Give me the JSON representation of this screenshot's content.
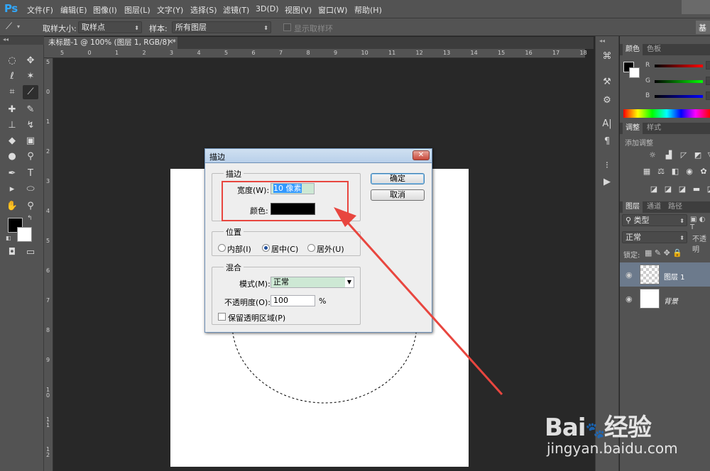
{
  "app": {
    "logo": "Ps"
  },
  "menu": [
    "文件(F)",
    "编辑(E)",
    "图像(I)",
    "图层(L)",
    "文字(Y)",
    "选择(S)",
    "滤镜(T)",
    "3D(D)",
    "视图(V)",
    "窗口(W)",
    "帮助(H)"
  ],
  "options": {
    "sample_size_label": "取样大小:",
    "sample_size_value": "取样点",
    "sample_label": "样本:",
    "sample_value": "所有图层",
    "show_ring": "显示取样环",
    "right_btn": "基"
  },
  "document": {
    "tab_title": "未标题-1 @ 100% (图层 1, RGB/8) *"
  },
  "ruler": {
    "top": [
      "5",
      "0",
      "1",
      "2",
      "3",
      "4",
      "5",
      "6",
      "7",
      "8",
      "9",
      "10",
      "11",
      "12",
      "13",
      "14",
      "15",
      "16",
      "17",
      "18"
    ],
    "left": [
      "5",
      "0",
      "1",
      "2",
      "3",
      "4",
      "5",
      "6",
      "7",
      "8",
      "9",
      "10",
      "11",
      "12"
    ]
  },
  "panels": {
    "color_tabs": [
      "颜色",
      "色板"
    ],
    "color_channels": [
      "R",
      "G",
      "B"
    ],
    "adjust_tabs": [
      "调整",
      "样式"
    ],
    "adjust_title": "添加调整",
    "layers_tabs": [
      "图层",
      "通道",
      "路径"
    ],
    "layer_filter": "类型",
    "blend_mode": "正常",
    "opacity_partial": "不透明",
    "lock_label": "锁定:",
    "layers": [
      {
        "name": "图层 1"
      },
      {
        "name": "背景"
      }
    ]
  },
  "dialog": {
    "title": "描边",
    "stroke_group": "描边",
    "width_label": "宽度(W):",
    "width_value": "10 像素",
    "color_label": "颜色:",
    "position_group": "位置",
    "pos_inside": "内部(I)",
    "pos_center": "居中(C)",
    "pos_outside": "居外(U)",
    "blend_group": "混合",
    "mode_label": "模式(M):",
    "mode_value": "正常",
    "opacity_label": "不透明度(O):",
    "opacity_value": "100",
    "opacity_unit": "%",
    "preserve_label": "保留透明区域(P)",
    "ok": "确定",
    "cancel": "取消"
  },
  "watermark": {
    "brand": "Bai",
    "brand2": "经验",
    "url": "jingyan.baidu.com"
  },
  "colors": {
    "accent_red": "#e8463f",
    "ps_blue": "#31a8ff"
  }
}
